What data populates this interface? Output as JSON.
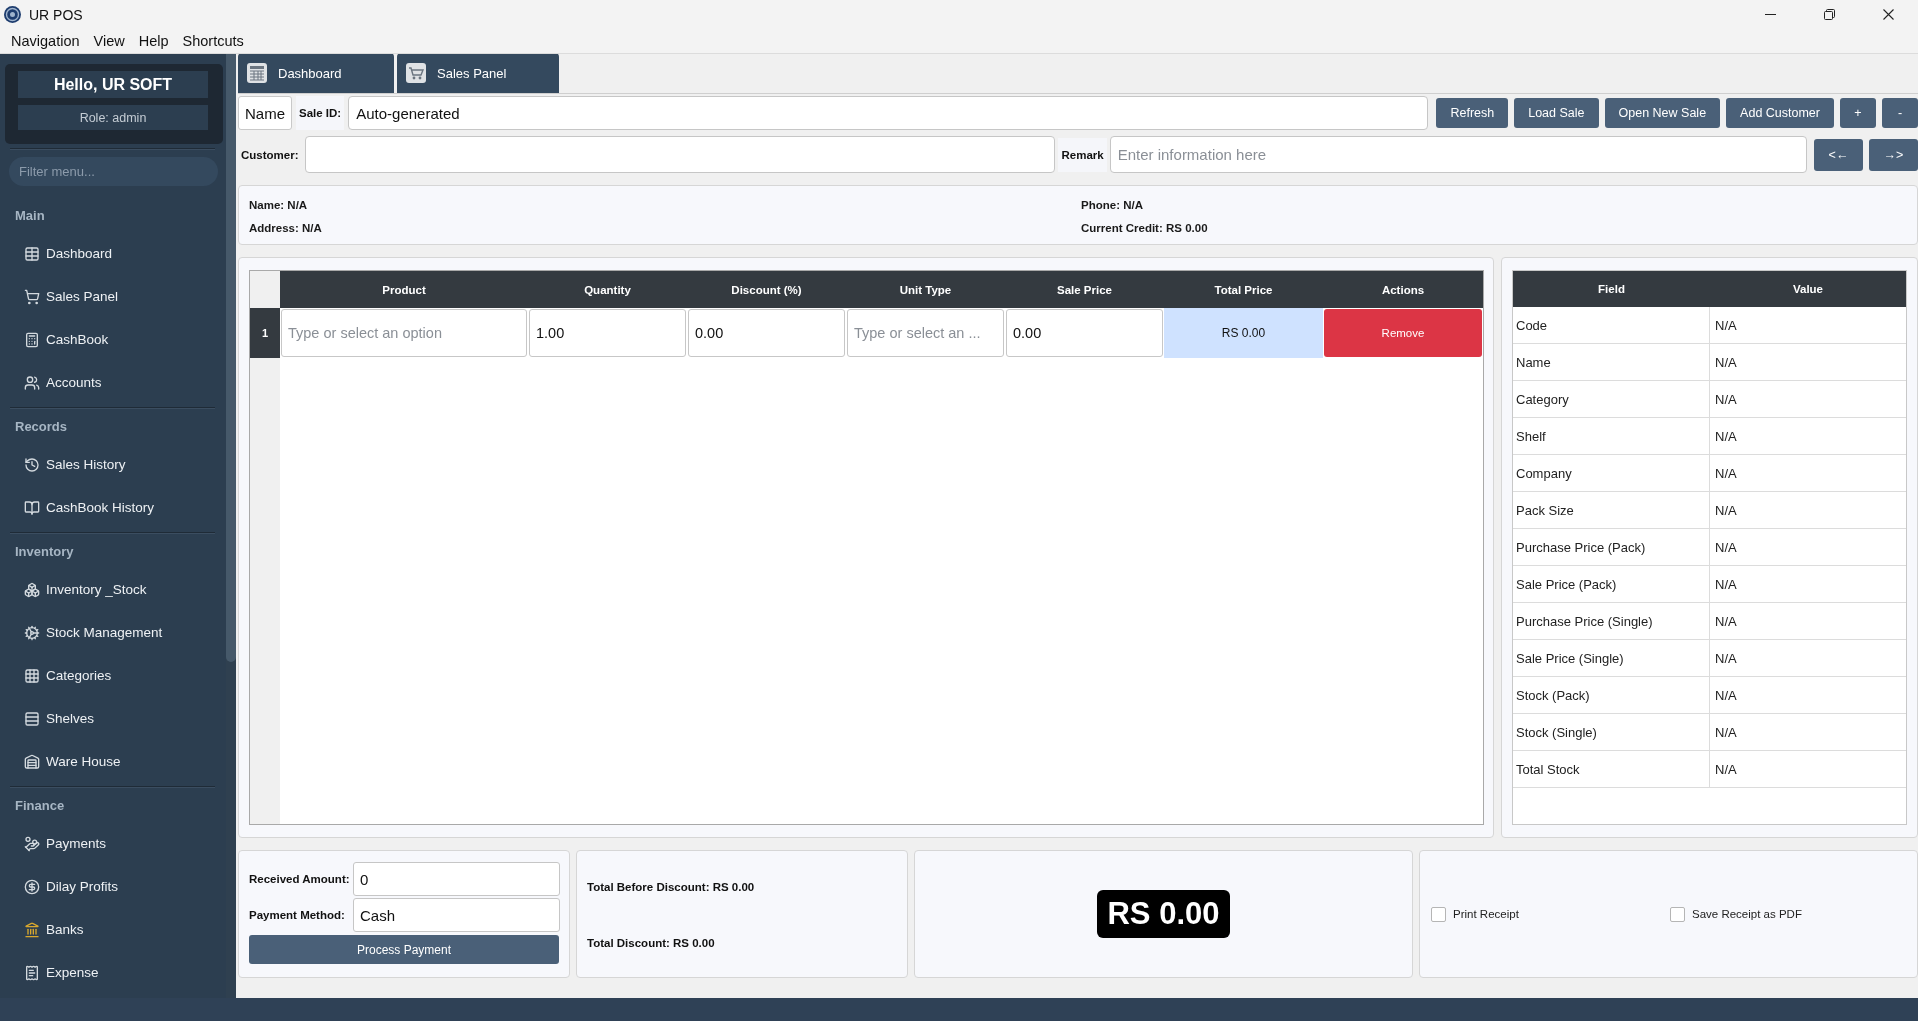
{
  "window": {
    "title": "UR POS"
  },
  "menu_bar": [
    "Navigation",
    "View",
    "Help",
    "Shortcuts"
  ],
  "sidebar": {
    "greeting": "Hello, UR SOFT",
    "role": "Role: admin",
    "filter": {
      "placeholder": "Filter menu..."
    },
    "sections": [
      {
        "title": "Main",
        "items": [
          "Dashboard",
          "Sales Panel",
          "CashBook",
          "Accounts"
        ]
      },
      {
        "title": "Records",
        "items": [
          "Sales History",
          "CashBook History"
        ]
      },
      {
        "title": "Inventory",
        "items": [
          "Inventory _Stock",
          "Stock Management",
          "Categories",
          "Shelves",
          "Ware House"
        ]
      },
      {
        "title": "Finance",
        "items": [
          "Payments",
          "Dilay Profits",
          "Banks",
          "Expense"
        ]
      }
    ]
  },
  "tabs": [
    {
      "label": "Dashboard"
    },
    {
      "label": "Sales Panel"
    }
  ],
  "sale_bar": {
    "name_label": "Name",
    "sale_id_label": "Sale ID:",
    "sale_id": {
      "value": "Auto-generated"
    },
    "buttons": [
      "Refresh",
      "Load Sale",
      "Open New Sale",
      "Add Customer",
      "+",
      "-"
    ]
  },
  "customer_bar": {
    "customer_label": "Customer:",
    "remark_label": "Remark",
    "remark": {
      "placeholder": "Enter information here"
    },
    "buttons": [
      "<←",
      "→>"
    ]
  },
  "customer_info": {
    "name": "Name: N/A",
    "address": "Address: N/A",
    "phone": "Phone: N/A",
    "current_credit": "Current Credit: RS 0.00"
  },
  "cart_table": {
    "columns": [
      "Product",
      "Quantity",
      "Discount (%)",
      "Unit Type",
      "Sale Price",
      "Total Price",
      "Actions"
    ],
    "rows": [
      {
        "number": "1",
        "product": {
          "placeholder": "Type or select an option"
        },
        "quantity": "1.00",
        "discount": "0.00",
        "unit_type": {
          "placeholder": "Type or select an ..."
        },
        "sale_price": "0.00",
        "total_price": "RS 0.00",
        "action": "Remove"
      }
    ]
  },
  "product_details": {
    "columns": [
      "Field",
      "Value"
    ],
    "rows": [
      {
        "field": "Code",
        "value": "N/A"
      },
      {
        "field": "Name",
        "value": "N/A"
      },
      {
        "field": "Category",
        "value": "N/A"
      },
      {
        "field": "Shelf",
        "value": "N/A"
      },
      {
        "field": "Company",
        "value": "N/A"
      },
      {
        "field": "Pack Size",
        "value": "N/A"
      },
      {
        "field": "Purchase Price (Pack)",
        "value": "N/A"
      },
      {
        "field": "Sale Price (Pack)",
        "value": "N/A"
      },
      {
        "field": "Purchase Price (Single)",
        "value": "N/A"
      },
      {
        "field": "Sale Price (Single)",
        "value": "N/A"
      },
      {
        "field": "Stock (Pack)",
        "value": "N/A"
      },
      {
        "field": "Stock (Single)",
        "value": "N/A"
      },
      {
        "field": "Total Stock",
        "value": "N/A"
      }
    ]
  },
  "payment": {
    "received_amount_label": "Received Amount:",
    "received_amount": "0",
    "payment_method_label": "Payment Method:",
    "payment_method": "Cash",
    "process_button": "Process Payment"
  },
  "totals": {
    "before_discount": "Total Before Discount: RS 0.00",
    "discount": "Total Discount: RS 0.00"
  },
  "grand_total": "RS 0.00",
  "receipt_options": [
    {
      "label": "Print Receipt",
      "checked": false
    },
    {
      "label": "Save Receipt as PDF",
      "checked": false
    }
  ]
}
